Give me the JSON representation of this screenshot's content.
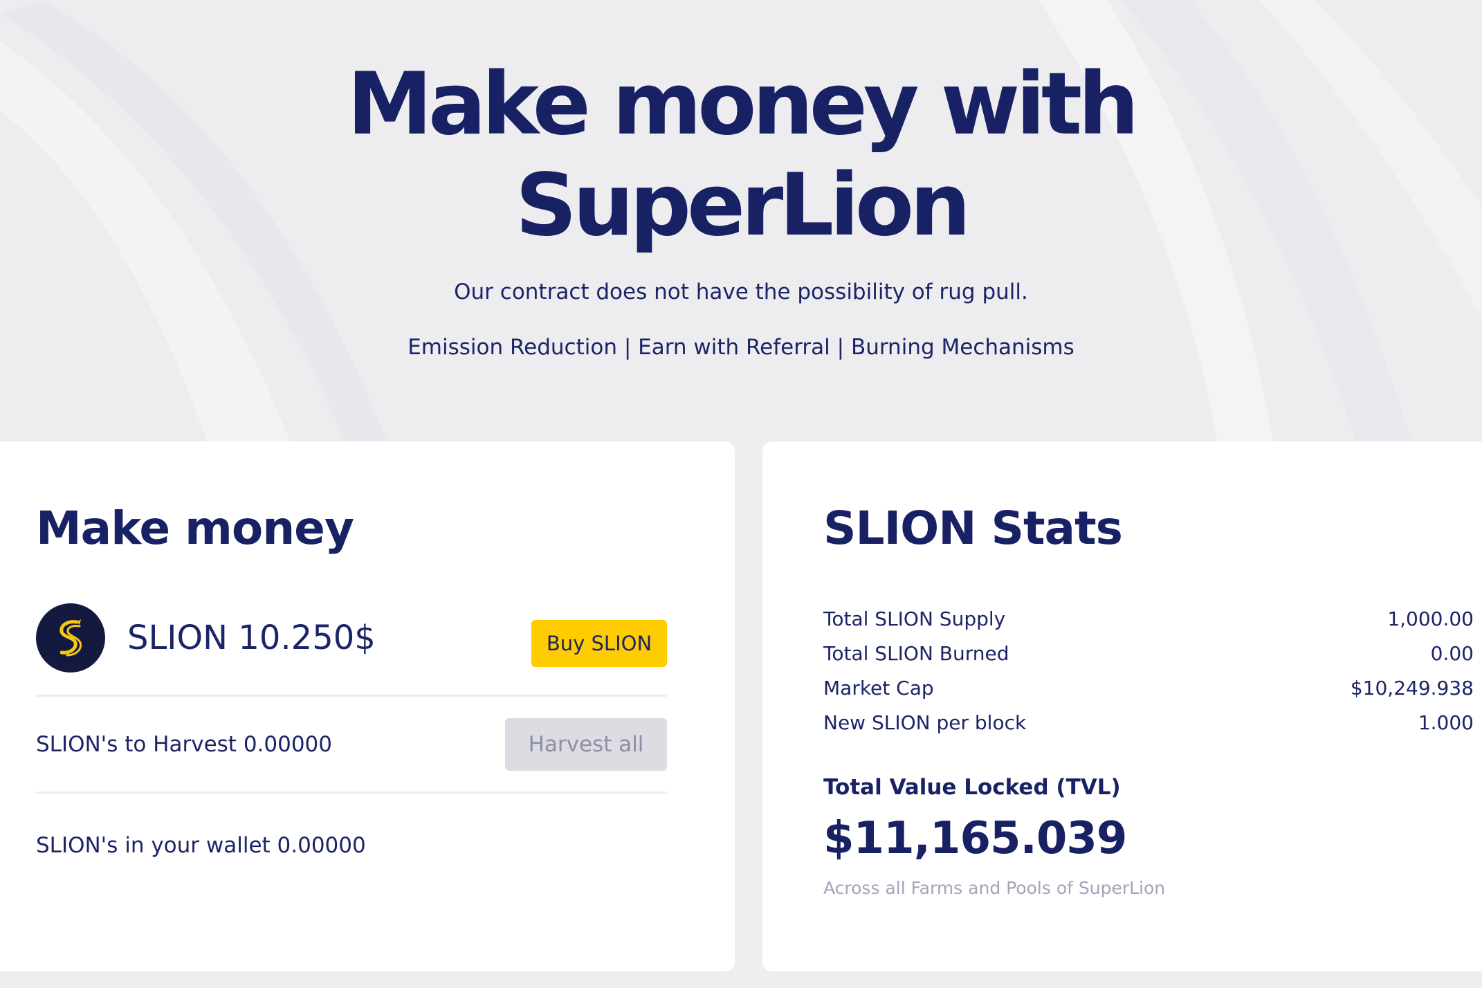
{
  "hero": {
    "title": "Make money with\nSuperLion",
    "subtitle": "Our contract does not have the possibility of rug pull.",
    "features": "Emission Reduction | Earn with Referral | Burning Mechanisms"
  },
  "earn_card": {
    "title": "Make money",
    "token_price": "SLION 10.250$",
    "buy_button": "Buy SLION",
    "harvest_text": "SLION's to Harvest 0.00000",
    "harvest_button": "Harvest all",
    "wallet_text": "SLION's in your wallet 0.00000",
    "logo_icon": "superlion-logo-icon"
  },
  "stats_card": {
    "title": "SLION Stats",
    "rows": [
      {
        "label": "Total SLION Supply",
        "value": "1,000.00"
      },
      {
        "label": "Total SLION Burned",
        "value": "0.00"
      },
      {
        "label": "Market Cap",
        "value": "$10,249.938"
      },
      {
        "label": "New SLION per block",
        "value": "1.000"
      }
    ],
    "tvl_label": "Total Value Locked (TVL)",
    "tvl_value": "$11,165.039",
    "tvl_note": "Across all Farms and Pools of SuperLion"
  },
  "colors": {
    "primary_text": "#182163",
    "accent_yellow": "#ffcc00",
    "disabled_button": "#dcdce2",
    "page_background": "#eeeef1",
    "card_background": "#ffffff"
  }
}
